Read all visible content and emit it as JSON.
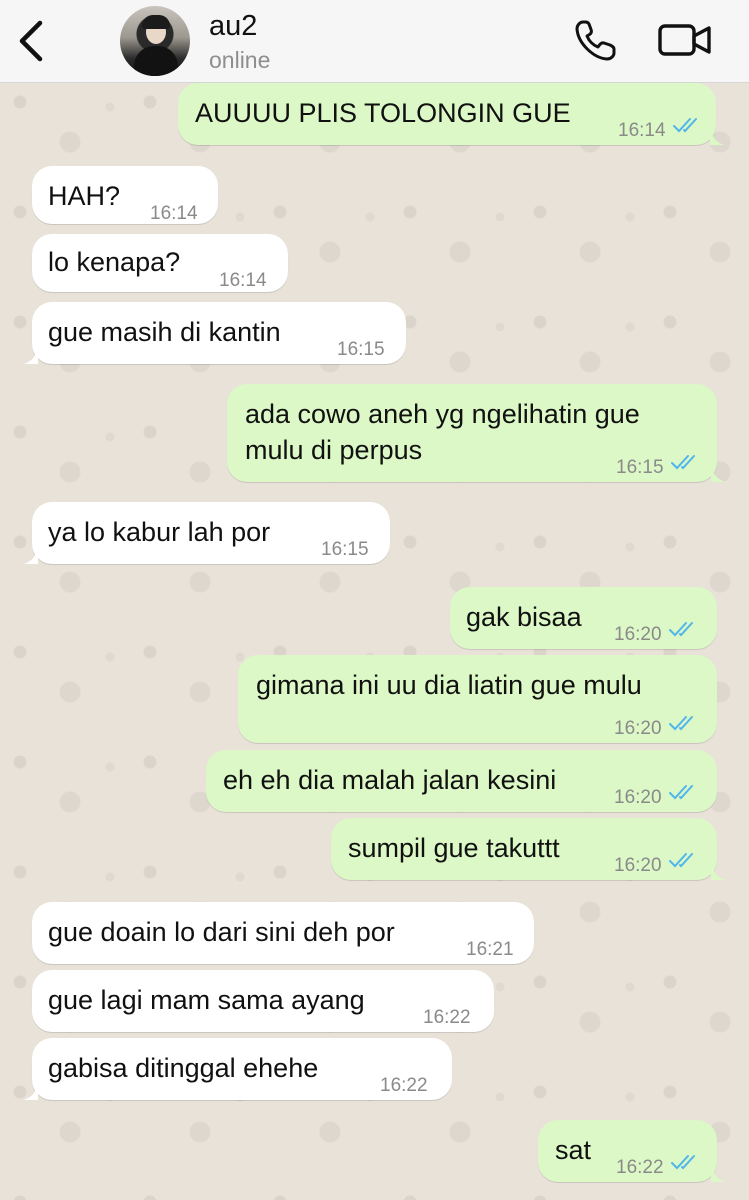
{
  "header": {
    "contact_name": "au2",
    "status": "online"
  },
  "messages": [
    {
      "dir": "out",
      "text": "AUUUU PLIS TOLONGIN GUE",
      "time": "16:14",
      "read": true
    },
    {
      "dir": "in",
      "text": "HAH?",
      "time": "16:14"
    },
    {
      "dir": "in",
      "text": "lo kenapa?",
      "time": "16:14"
    },
    {
      "dir": "in",
      "text": "gue masih di kantin",
      "time": "16:15"
    },
    {
      "dir": "out",
      "text": "ada cowo aneh yg ngelihatin gue mulu di perpus",
      "time": "16:15",
      "read": true
    },
    {
      "dir": "in",
      "text": "ya lo kabur lah por",
      "time": "16:15"
    },
    {
      "dir": "out",
      "text": "gak bisaa",
      "time": "16:20",
      "read": true
    },
    {
      "dir": "out",
      "text": "gimana ini uu dia liatin gue mulu",
      "time": "16:20",
      "read": true
    },
    {
      "dir": "out",
      "text": "eh eh dia malah jalan kesini",
      "time": "16:20",
      "read": true
    },
    {
      "dir": "out",
      "text": "sumpil gue takuttt",
      "time": "16:20",
      "read": true
    },
    {
      "dir": "in",
      "text": "gue doain lo dari sini deh por",
      "time": "16:21"
    },
    {
      "dir": "in",
      "text": "gue lagi mam sama ayang",
      "time": "16:22"
    },
    {
      "dir": "in",
      "text": "gabisa ditinggal ehehe",
      "time": "16:22"
    },
    {
      "dir": "out",
      "text": "sat",
      "time": "16:22",
      "read": true
    }
  ],
  "colors": {
    "outgoing_bubble": "#dcf8c6",
    "incoming_bubble": "#ffffff",
    "read_check": "#4fb6ec",
    "wallpaper": "#e8e2d9"
  }
}
